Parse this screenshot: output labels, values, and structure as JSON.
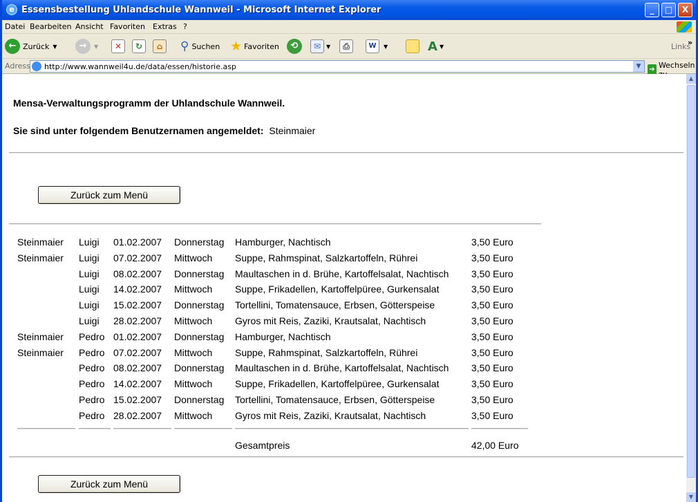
{
  "window": {
    "title": "Essensbestellung Uhlandschule Wannweil - Microsoft Internet Explorer",
    "controls": {
      "minimize": "_",
      "maximize": "□",
      "close": "X"
    }
  },
  "menu": [
    "Datei",
    "Bearbeiten",
    "Ansicht",
    "Favoriten",
    "Extras",
    "?"
  ],
  "toolbar": {
    "back_label": "Zurück",
    "search_label": "Suchen",
    "favorites_label": "Favoriten",
    "links_label": "Links",
    "overflow": "»"
  },
  "address": {
    "label": "Adresse",
    "url": "http://www.wannweil4u.de/data/essen/historie.asp",
    "go_label": "Wechseln zu"
  },
  "page": {
    "heading": "Mensa-Verwaltungsprogramm der Uhlandschule Wannweil.",
    "login_prefix": "Sie sind unter folgendem Benutzernamen angemeldet:",
    "username": "Steinmaier",
    "back_button_top": "Zurück zum Menü",
    "back_button_bottom": "Zurück zum Menü",
    "total_label": "Gesamtpreis",
    "total_value": "42,00 Euro"
  },
  "orders": [
    {
      "user": "Steinmaier",
      "kid": "Luigi",
      "date": "01.02.2007",
      "day": "Donnerstag",
      "meal": "Hamburger, Nachtisch",
      "price": "3,50 Euro"
    },
    {
      "user": "Steinmaier",
      "kid": "Luigi",
      "date": "07.02.2007",
      "day": "Mittwoch",
      "meal": "Suppe, Rahmspinat, Salzkartoffeln, Rührei",
      "price": "3,50 Euro"
    },
    {
      "user": "",
      "kid": "Luigi",
      "date": "08.02.2007",
      "day": "Donnerstag",
      "meal": "Maultaschen in d. Brühe, Kartoffelsalat, Nachtisch",
      "price": "3,50 Euro"
    },
    {
      "user": "",
      "kid": "Luigi",
      "date": "14.02.2007",
      "day": "Mittwoch",
      "meal": "Suppe, Frikadellen, Kartoffelpüree, Gurkensalat",
      "price": "3,50 Euro"
    },
    {
      "user": "",
      "kid": "Luigi",
      "date": "15.02.2007",
      "day": "Donnerstag",
      "meal": "Tortellini, Tomatensauce, Erbsen, Götterspeise",
      "price": "3,50 Euro"
    },
    {
      "user": "",
      "kid": "Luigi",
      "date": "28.02.2007",
      "day": "Mittwoch",
      "meal": "Gyros mit Reis, Zaziki, Krautsalat, Nachtisch",
      "price": "3,50 Euro"
    },
    {
      "user": "Steinmaier",
      "kid": "Pedro",
      "date": "01.02.2007",
      "day": "Donnerstag",
      "meal": "Hamburger, Nachtisch",
      "price": "3,50 Euro"
    },
    {
      "user": "Steinmaier",
      "kid": "Pedro",
      "date": "07.02.2007",
      "day": "Mittwoch",
      "meal": "Suppe, Rahmspinat, Salzkartoffeln, Rührei",
      "price": "3,50 Euro"
    },
    {
      "user": "",
      "kid": "Pedro",
      "date": "08.02.2007",
      "day": "Donnerstag",
      "meal": "Maultaschen in d. Brühe, Kartoffelsalat, Nachtisch",
      "price": "3,50 Euro"
    },
    {
      "user": "",
      "kid": "Pedro",
      "date": "14.02.2007",
      "day": "Mittwoch",
      "meal": "Suppe, Frikadellen, Kartoffelpüree, Gurkensalat",
      "price": "3,50 Euro"
    },
    {
      "user": "",
      "kid": "Pedro",
      "date": "15.02.2007",
      "day": "Donnerstag",
      "meal": "Tortellini, Tomatensauce, Erbsen, Götterspeise",
      "price": "3,50 Euro"
    },
    {
      "user": "",
      "kid": "Pedro",
      "date": "28.02.2007",
      "day": "Mittwoch",
      "meal": "Gyros mit Reis, Zaziki, Krautsalat, Nachtisch",
      "price": "3,50 Euro"
    }
  ]
}
